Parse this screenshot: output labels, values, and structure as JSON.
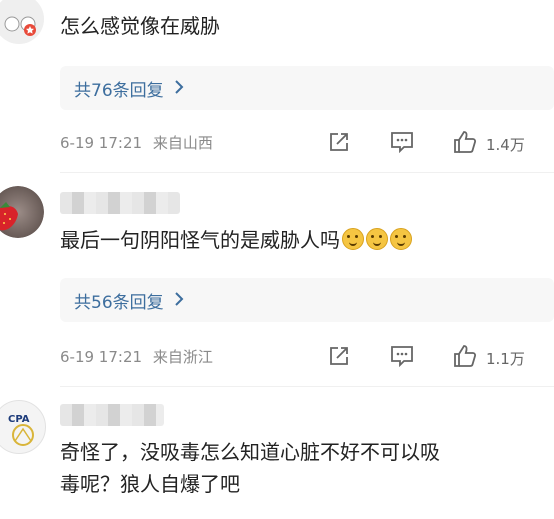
{
  "comments": [
    {
      "text": "怎么感觉像在威胁",
      "replies_label": "共76条回复",
      "time": "6-19 17:21",
      "location": "来自山西",
      "likes": "1.4万"
    },
    {
      "text": "最后一句阴阳怪气的是威胁人吗",
      "replies_label": "共56条回复",
      "time": "6-19 17:21",
      "location": "来自浙江",
      "likes": "1.1万"
    },
    {
      "avatar_text": "CPA",
      "text_line1": "奇怪了，没吸毒怎么知道心脏不好不可以吸",
      "text_line2": "毒呢？狼人自爆了吧"
    }
  ],
  "icons": {
    "chevron": "chevron-right-icon",
    "share": "share-icon",
    "comment": "comment-icon",
    "like": "thumbs-up-icon"
  },
  "colors": {
    "link": "#3d6e9e",
    "meta": "#8a8a8a",
    "reply_bg": "#f7f7f7"
  }
}
